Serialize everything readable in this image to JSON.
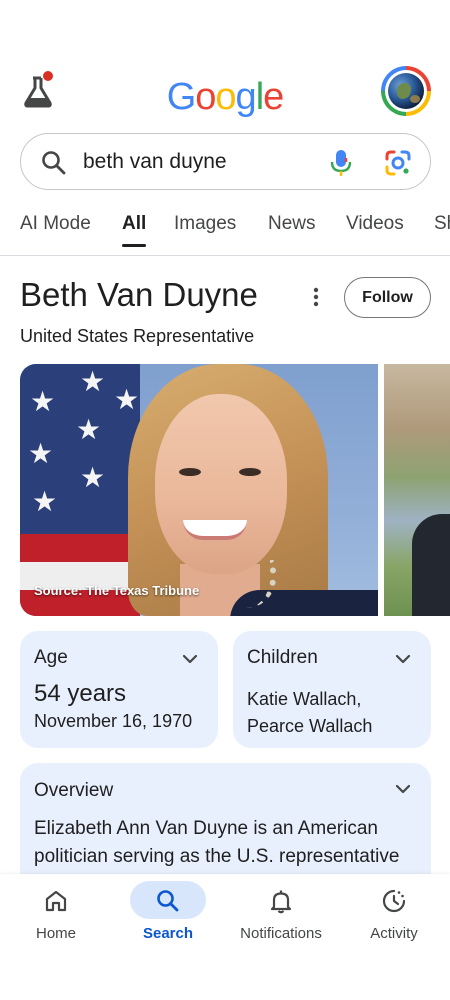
{
  "header": {
    "logo_letters": [
      "G",
      "o",
      "o",
      "g",
      "l",
      "e"
    ],
    "logo_colors": [
      "#4285f4",
      "#ea4335",
      "#fbbc05",
      "#4285f4",
      "#34a853",
      "#ea4335"
    ],
    "labs_icon": "flask-icon",
    "avatar_icon": "earth-avatar"
  },
  "search": {
    "query": "beth van duyne",
    "icons": [
      "search-icon",
      "mic-icon",
      "google-lens-icon"
    ]
  },
  "tabs": [
    {
      "label": "AI Mode",
      "active": false
    },
    {
      "label": "All",
      "active": true
    },
    {
      "label": "Images",
      "active": false
    },
    {
      "label": "News",
      "active": false
    },
    {
      "label": "Videos",
      "active": false
    },
    {
      "label": "Sh",
      "active": false
    }
  ],
  "knowledge_panel": {
    "title": "Beth Van Duyne",
    "subtitle": "United States Representative",
    "follow_label": "Follow",
    "image_source": "Source: The Texas Tribune",
    "age": {
      "label": "Age",
      "value": "54 years",
      "date": "November 16, 1970"
    },
    "children": {
      "label": "Children",
      "line1": "Katie Wallach,",
      "line2": "Pearce Wallach"
    },
    "overview": {
      "label": "Overview",
      "text": "Elizabeth Ann Van Duyne is an American politician serving as the U.S. representative"
    }
  },
  "bottom_nav": [
    {
      "label": "Home",
      "icon": "home-icon",
      "active": false
    },
    {
      "label": "Search",
      "icon": "search-icon",
      "active": true
    },
    {
      "label": "Notifications",
      "icon": "bell-icon",
      "active": false
    },
    {
      "label": "Activity",
      "icon": "activity-icon",
      "active": false
    }
  ],
  "colors": {
    "accent": "#0b57d0",
    "card_bg": "#e8effd",
    "nav_active_bg": "#d8e6fc"
  }
}
